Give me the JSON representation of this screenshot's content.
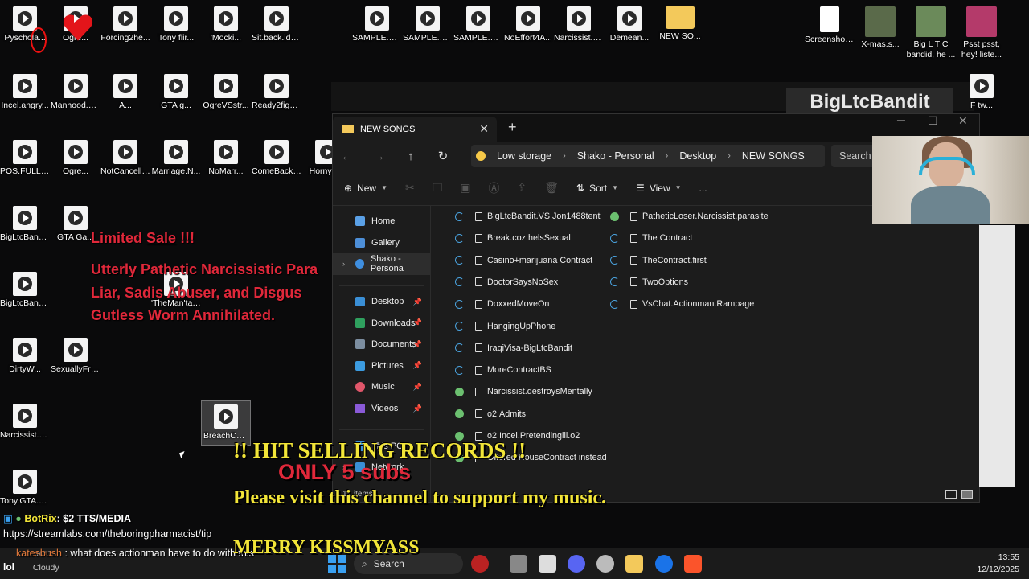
{
  "desktop": {
    "icons_row1": [
      {
        "label": "Pyschola..."
      },
      {
        "label": "Ogre..."
      },
      {
        "label": "Forcing2he..."
      },
      {
        "label": "Tony flir..."
      },
      {
        "label": "'Mocki..."
      },
      {
        "label": "Sit.back.idc..."
      },
      {
        "label": "SAMPLE.Na..."
      },
      {
        "label": "SAMPLE.Hid..."
      },
      {
        "label": "SAMPLE.Ca..."
      },
      {
        "label": "NoEffort4A..."
      },
      {
        "label": "Narcissist.Fi..."
      },
      {
        "label": "Demean..."
      },
      {
        "label": "NEW SO..."
      },
      {
        "label": "Screenshot_..."
      },
      {
        "label": "X-mas.s..."
      },
      {
        "label": "Big L T C bandid, he ..."
      },
      {
        "label": "Psst psst, hey! liste..."
      }
    ],
    "icons_row2": [
      {
        "label": "Incel.angry..."
      },
      {
        "label": "Manhood.H..."
      },
      {
        "label": "A..."
      },
      {
        "label": "GTA g..."
      },
      {
        "label": "OgreVSstr..."
      },
      {
        "label": "Ready2fight..."
      },
      {
        "label": "F tw..."
      }
    ],
    "icons_row3": [
      {
        "label": "POS.FULL.N..."
      },
      {
        "label": "Ogre..."
      },
      {
        "label": "NotCancelli..."
      },
      {
        "label": "Marriage.N..."
      },
      {
        "label": "NoMarr..."
      },
      {
        "label": "ComeBackl..."
      },
      {
        "label": "Horny T..."
      }
    ],
    "icons_col": [
      {
        "label": "BigLtcBandi..."
      },
      {
        "label": "GTA Ga..."
      },
      {
        "label": "BigLtcBandi..."
      },
      {
        "label": "'TheMan'tal..."
      },
      {
        "label": "DirtyW..."
      },
      {
        "label": "SexuallyFru..."
      },
      {
        "label": "Narcissist.G..."
      },
      {
        "label": "BreachContract.Mario..."
      },
      {
        "label": "Tony.GTA.1..."
      }
    ],
    "promo": {
      "line1a": "Limited",
      "line1b": "Sale",
      "line1c": " !!!",
      "line2": "Utterly Pathetic Narcissistic Para",
      "line3": "Liar, Sadis    Abuser, and Disgus",
      "line4": "Gutless Worm Annihilated."
    },
    "watermark": "BigLtcBandit"
  },
  "explorer": {
    "tab_title": "NEW SONGS",
    "breadcrumbs": [
      "Low storage",
      "Shako - Personal",
      "Desktop",
      "NEW SONGS"
    ],
    "search_placeholder": "Search N",
    "toolbar": {
      "new": "New",
      "sort": "Sort",
      "view": "View",
      "more": "..."
    },
    "sidebar": [
      {
        "label": "Home"
      },
      {
        "label": "Gallery"
      },
      {
        "label": "Shako - Persona"
      },
      {
        "label": "Desktop"
      },
      {
        "label": "Downloads"
      },
      {
        "label": "Documents"
      },
      {
        "label": "Pictures"
      },
      {
        "label": "Music"
      },
      {
        "label": "Videos"
      },
      {
        "label": "This PC"
      },
      {
        "label": "Network"
      }
    ],
    "files_col1": [
      {
        "name": "BigLtcBandit.VS.Jon1488tent",
        "state": "sync"
      },
      {
        "name": "Break.coz.helsSexual",
        "state": "sync"
      },
      {
        "name": "Casino+marijuana Contract",
        "state": "sync"
      },
      {
        "name": "DoctorSaysNoSex",
        "state": "sync"
      },
      {
        "name": "DoxxedMoveOn",
        "state": "sync"
      },
      {
        "name": "HangingUpPhone",
        "state": "sync"
      },
      {
        "name": "IraqiVisa-BigLtcBandit",
        "state": "sync"
      },
      {
        "name": "MoreContractBS",
        "state": "sync"
      },
      {
        "name": "Narcissist.destroysMentally",
        "state": "ok"
      },
      {
        "name": "o2.Admits",
        "state": "ok"
      },
      {
        "name": "o2.Incel.Pretendingill.o2",
        "state": "ok"
      },
      {
        "name": "Offered HouseContract instead",
        "state": "ok"
      }
    ],
    "files_col2": [
      {
        "name": "PatheticLoser.Narcissist.parasite",
        "state": "ok"
      },
      {
        "name": "The Contract",
        "state": "sync"
      },
      {
        "name": "TheContract.first",
        "state": "sync"
      },
      {
        "name": "TwoOptions",
        "state": "sync"
      },
      {
        "name": "VsChat.Actionman.Rampage",
        "state": "sync"
      }
    ],
    "status": "17 items"
  },
  "overlays": {
    "hit": "!! HIT SELLING RECORDS !!",
    "subs": "ONLY 5 subs",
    "visit": "Please visit this channel to support my music.",
    "merry": "MERRY KISSMYASS"
  },
  "chat": {
    "bot_name": "BotRix",
    "bot_msg": ": $2 TTS/MEDIA",
    "link": "https://streamlabs.com/theboringpharmacist/tip",
    "user": "katesbush",
    "user_msg": " : what does actionman have to do with this",
    "lol": "lol"
  },
  "taskbar": {
    "weather_temp": "10°C",
    "weather": "Cloudy",
    "search": "Search",
    "time": "13:55",
    "date": "12/12/2025"
  },
  "colors": {
    "accent": "#3aa0f0",
    "promo_red": "#e0283a",
    "overlay_yellow": "#f2e538"
  }
}
